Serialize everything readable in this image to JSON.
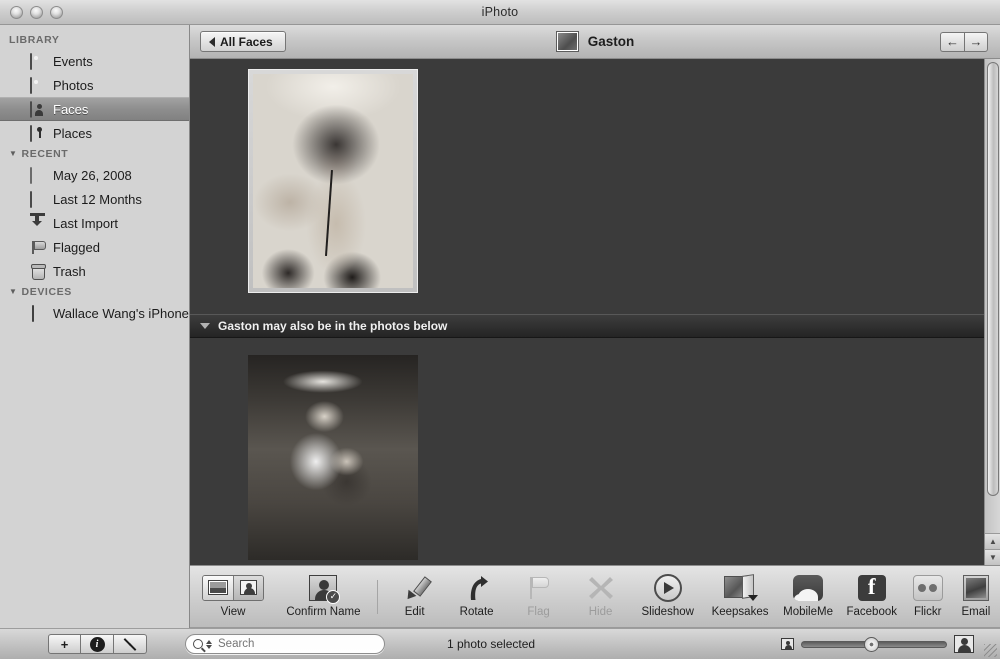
{
  "window": {
    "title": "iPhoto",
    "controls": [
      "close",
      "minimize",
      "zoom"
    ]
  },
  "sidebar": {
    "sections": [
      {
        "header": "LIBRARY",
        "items": [
          {
            "label": "Events",
            "icon": "events-icon",
            "selected": false
          },
          {
            "label": "Photos",
            "icon": "photos-icon",
            "selected": false
          },
          {
            "label": "Faces",
            "icon": "faces-icon",
            "selected": true
          },
          {
            "label": "Places",
            "icon": "places-icon",
            "selected": false
          }
        ]
      },
      {
        "header": "RECENT",
        "items": [
          {
            "label": "May 26, 2008",
            "icon": "event-blank-icon",
            "selected": false
          },
          {
            "label": "Last 12 Months",
            "icon": "calendar-icon",
            "selected": false
          },
          {
            "label": "Last Import",
            "icon": "import-icon",
            "selected": false
          },
          {
            "label": "Flagged",
            "icon": "flag-icon",
            "selected": false
          },
          {
            "label": "Trash",
            "icon": "trash-icon",
            "selected": false
          }
        ]
      },
      {
        "header": "DEVICES",
        "items": [
          {
            "label": "Wallace Wang's iPhone",
            "icon": "iphone-icon",
            "selected": false
          }
        ]
      }
    ]
  },
  "navbar": {
    "back_label": "All Faces",
    "title": "Gaston",
    "prev_label": "←",
    "next_label": "→"
  },
  "suggestion_bar": {
    "text": "Gaston may also be in the photos below",
    "expanded": true
  },
  "toolbar": {
    "items": [
      {
        "label": "View",
        "icon": "view-segmented-icon",
        "enabled": true
      },
      {
        "label": "Confirm Name",
        "icon": "confirm-name-icon",
        "enabled": true
      },
      {
        "label": "Edit",
        "icon": "pencil-icon",
        "enabled": true
      },
      {
        "label": "Rotate",
        "icon": "rotate-icon",
        "enabled": true
      },
      {
        "label": "Flag",
        "icon": "flag-icon",
        "enabled": false
      },
      {
        "label": "Hide",
        "icon": "hide-x-icon",
        "enabled": false
      },
      {
        "label": "Slideshow",
        "icon": "play-icon",
        "enabled": true
      },
      {
        "label": "Keepsakes",
        "icon": "book-icon",
        "enabled": true
      },
      {
        "label": "MobileMe",
        "icon": "cloud-icon",
        "enabled": true
      },
      {
        "label": "Facebook",
        "icon": "facebook-icon",
        "enabled": true
      },
      {
        "label": "Flickr",
        "icon": "flickr-icon",
        "enabled": true
      },
      {
        "label": "Email",
        "icon": "stamp-icon",
        "enabled": true
      }
    ]
  },
  "statusbar": {
    "add_label": "+",
    "info_label": "i",
    "fullscreen_label": "fullscreen",
    "search_placeholder": "Search",
    "search_value": "",
    "selection_text": "1 photo selected",
    "zoom_value": 45
  },
  "colors": {
    "content_background": "#3b3b3b",
    "sidebar_background": "#d3d3d3",
    "selection": "#8e8e8e",
    "suggestion_bar": "#2f2f2f"
  }
}
